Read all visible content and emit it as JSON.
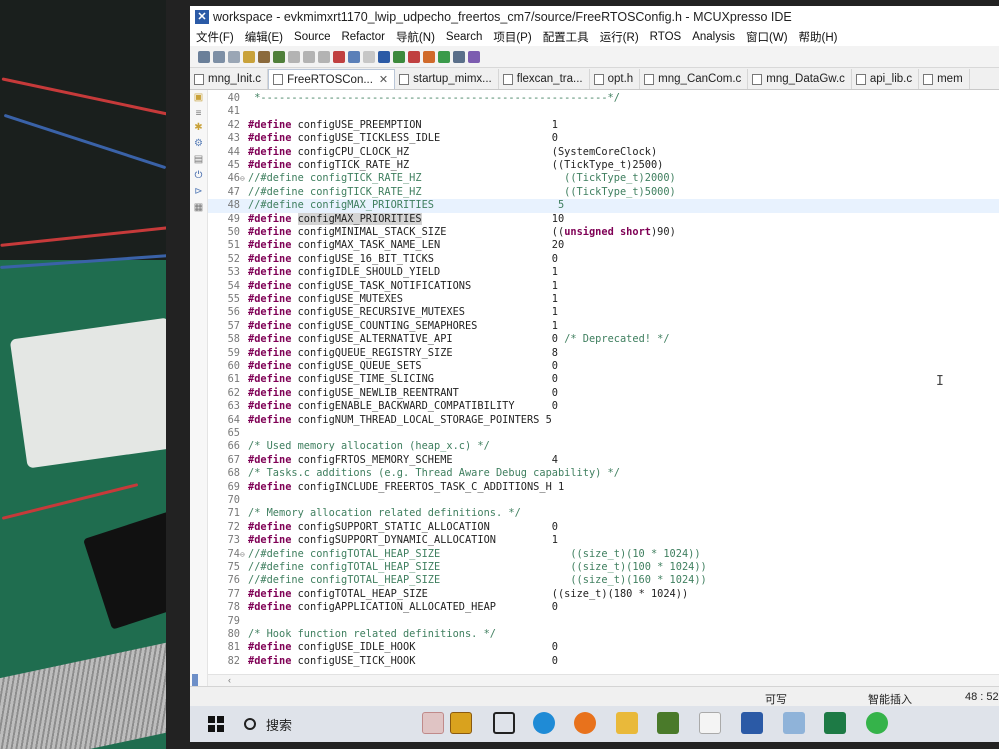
{
  "window": {
    "title": "workspace - evkmimxrt1170_lwip_udpecho_freertos_cm7/source/FreeRTOSConfig.h - MCUXpresso IDE",
    "app_icon": "x-icon"
  },
  "menu": [
    "文件(F)",
    "编辑(E)",
    "Source",
    "Refactor",
    "导航(N)",
    "Search",
    "项目(P)",
    "配置工具",
    "运行(R)",
    "RTOS",
    "Analysis",
    "窗口(W)",
    "帮助(H)"
  ],
  "tabs": [
    {
      "label": "mng_Init.c",
      "active": false,
      "closable": false
    },
    {
      "label": "FreeRTOSCon...",
      "active": true,
      "closable": true
    },
    {
      "label": "startup_mimx...",
      "active": false,
      "closable": false
    },
    {
      "label": "flexcan_tra...",
      "active": false,
      "closable": false
    },
    {
      "label": "opt.h",
      "active": false,
      "closable": false
    },
    {
      "label": "mng_CanCom.c",
      "active": false,
      "closable": false
    },
    {
      "label": "mng_DataGw.c",
      "active": false,
      "closable": false
    },
    {
      "label": "api_lib.c",
      "active": false,
      "closable": false
    },
    {
      "label": "mem",
      "active": false,
      "closable": false
    }
  ],
  "code_lines": [
    {
      "n": "40",
      "parts": [
        {
          "t": " *--------------------------------------------------------*/",
          "c": "cm"
        }
      ]
    },
    {
      "n": "41",
      "parts": []
    },
    {
      "n": "42",
      "parts": [
        {
          "t": "#define",
          "c": "kw"
        },
        {
          "t": " configUSE_PREEMPTION                     1"
        }
      ]
    },
    {
      "n": "43",
      "parts": [
        {
          "t": "#define",
          "c": "kw"
        },
        {
          "t": " configUSE_TICKLESS_IDLE                  0"
        }
      ]
    },
    {
      "n": "44",
      "parts": [
        {
          "t": "#define",
          "c": "kw"
        },
        {
          "t": " configCPU_CLOCK_HZ                       (SystemCoreClock)"
        }
      ]
    },
    {
      "n": "45",
      "parts": [
        {
          "t": "#define",
          "c": "kw"
        },
        {
          "t": " configTICK_RATE_HZ                       ((TickType_t)2500)"
        }
      ]
    },
    {
      "n": "46",
      "fold": "⊖",
      "parts": [
        {
          "t": "//#define configTICK_RATE_HZ                       ((TickType_t)2000)",
          "c": "cm"
        }
      ]
    },
    {
      "n": "47",
      "parts": [
        {
          "t": "//#define configTICK_RATE_HZ                       ((TickType_t)5000)",
          "c": "cm"
        }
      ]
    },
    {
      "n": "48",
      "hl": true,
      "parts": [
        {
          "t": "//#define configMAX_PRIORITIES                    5",
          "c": "cm"
        }
      ]
    },
    {
      "n": "49",
      "parts": [
        {
          "t": "#define",
          "c": "kw"
        },
        {
          "t": " "
        },
        {
          "t": "configMAX_PRIORITIES",
          "c": "sel"
        },
        {
          "t": "                     10"
        }
      ]
    },
    {
      "n": "50",
      "parts": [
        {
          "t": "#define",
          "c": "kw"
        },
        {
          "t": " configMINIMAL_STACK_SIZE                 (("
        },
        {
          "t": "unsigned short",
          "c": "kw"
        },
        {
          "t": ")90)"
        }
      ]
    },
    {
      "n": "51",
      "parts": [
        {
          "t": "#define",
          "c": "kw"
        },
        {
          "t": " configMAX_TASK_NAME_LEN                  20"
        }
      ]
    },
    {
      "n": "52",
      "parts": [
        {
          "t": "#define",
          "c": "kw"
        },
        {
          "t": " configUSE_16_BIT_TICKS                   0"
        }
      ]
    },
    {
      "n": "53",
      "parts": [
        {
          "t": "#define",
          "c": "kw"
        },
        {
          "t": " configIDLE_SHOULD_YIELD                  1"
        }
      ]
    },
    {
      "n": "54",
      "parts": [
        {
          "t": "#define",
          "c": "kw"
        },
        {
          "t": " configUSE_TASK_NOTIFICATIONS             1"
        }
      ]
    },
    {
      "n": "55",
      "parts": [
        {
          "t": "#define",
          "c": "kw"
        },
        {
          "t": " configUSE_MUTEXES                        1"
        }
      ]
    },
    {
      "n": "56",
      "parts": [
        {
          "t": "#define",
          "c": "kw"
        },
        {
          "t": " configUSE_RECURSIVE_MUTEXES              1"
        }
      ]
    },
    {
      "n": "57",
      "parts": [
        {
          "t": "#define",
          "c": "kw"
        },
        {
          "t": " configUSE_COUNTING_SEMAPHORES            1"
        }
      ]
    },
    {
      "n": "58",
      "parts": [
        {
          "t": "#define",
          "c": "kw"
        },
        {
          "t": " configUSE_ALTERNATIVE_API                0 "
        },
        {
          "t": "/* Deprecated! */",
          "c": "cm"
        }
      ]
    },
    {
      "n": "59",
      "parts": [
        {
          "t": "#define",
          "c": "kw"
        },
        {
          "t": " configQUEUE_REGISTRY_SIZE                8"
        }
      ]
    },
    {
      "n": "60",
      "parts": [
        {
          "t": "#define",
          "c": "kw"
        },
        {
          "t": " configUSE_QUEUE_SETS                     0"
        }
      ]
    },
    {
      "n": "61",
      "parts": [
        {
          "t": "#define",
          "c": "kw"
        },
        {
          "t": " configUSE_TIME_SLICING                   0"
        }
      ]
    },
    {
      "n": "62",
      "parts": [
        {
          "t": "#define",
          "c": "kw"
        },
        {
          "t": " configUSE_NEWLIB_REENTRANT               0"
        }
      ]
    },
    {
      "n": "63",
      "parts": [
        {
          "t": "#define",
          "c": "kw"
        },
        {
          "t": " configENABLE_BACKWARD_COMPATIBILITY      0"
        }
      ]
    },
    {
      "n": "64",
      "parts": [
        {
          "t": "#define",
          "c": "kw"
        },
        {
          "t": " configNUM_THREAD_LOCAL_STORAGE_POINTERS 5"
        }
      ]
    },
    {
      "n": "65",
      "parts": []
    },
    {
      "n": "66",
      "parts": [
        {
          "t": "/* Used memory allocation (heap_x.c) */",
          "c": "cm"
        }
      ]
    },
    {
      "n": "67",
      "parts": [
        {
          "t": "#define",
          "c": "kw"
        },
        {
          "t": " configFRTOS_MEMORY_SCHEME                4"
        }
      ]
    },
    {
      "n": "68",
      "parts": [
        {
          "t": "/* Tasks.c additions (e.g. Thread Aware Debug capability) */",
          "c": "cm"
        }
      ]
    },
    {
      "n": "69",
      "parts": [
        {
          "t": "#define",
          "c": "kw"
        },
        {
          "t": " configINCLUDE_FREERTOS_TASK_C_ADDITIONS_H 1"
        }
      ]
    },
    {
      "n": "70",
      "parts": []
    },
    {
      "n": "71",
      "parts": [
        {
          "t": "/* Memory allocation related definitions. */",
          "c": "cm"
        }
      ]
    },
    {
      "n": "72",
      "parts": [
        {
          "t": "#define",
          "c": "kw"
        },
        {
          "t": " configSUPPORT_STATIC_ALLOCATION          0"
        }
      ]
    },
    {
      "n": "73",
      "parts": [
        {
          "t": "#define",
          "c": "kw"
        },
        {
          "t": " configSUPPORT_DYNAMIC_ALLOCATION         1"
        }
      ]
    },
    {
      "n": "74",
      "fold": "⊖",
      "parts": [
        {
          "t": "//#define configTOTAL_HEAP_SIZE                     ((size_t)(10 * 1024))",
          "c": "cm"
        }
      ]
    },
    {
      "n": "75",
      "parts": [
        {
          "t": "//#define configTOTAL_HEAP_SIZE                     ((size_t)(100 * 1024))",
          "c": "cm"
        }
      ]
    },
    {
      "n": "76",
      "parts": [
        {
          "t": "//#define configTOTAL_HEAP_SIZE                     ((size_t)(160 * 1024))",
          "c": "cm"
        }
      ]
    },
    {
      "n": "77",
      "parts": [
        {
          "t": "#define",
          "c": "kw"
        },
        {
          "t": " configTOTAL_HEAP_SIZE                    ((size_t)(180 * 1024))"
        }
      ]
    },
    {
      "n": "78",
      "parts": [
        {
          "t": "#define",
          "c": "kw"
        },
        {
          "t": " configAPPLICATION_ALLOCATED_HEAP         0"
        }
      ]
    },
    {
      "n": "79",
      "parts": []
    },
    {
      "n": "80",
      "parts": [
        {
          "t": "/* Hook function related definitions. */",
          "c": "cm"
        }
      ]
    },
    {
      "n": "81",
      "parts": [
        {
          "t": "#define",
          "c": "kw"
        },
        {
          "t": " configUSE_IDLE_HOOK                      0"
        }
      ]
    },
    {
      "n": "82",
      "parts": [
        {
          "t": "#define",
          "c": "kw"
        },
        {
          "t": " configUSE_TICK_HOOK                      0"
        }
      ]
    }
  ],
  "status": {
    "writable": "可写",
    "insert_mode": "智能插入",
    "cursor_position": "48 : 52"
  },
  "taskbar": {
    "search_label": "搜索",
    "apps": [
      "paint-icon",
      "sunflower-icon",
      "task-view-icon",
      "edge-icon",
      "firefox-icon",
      "explorer-icon",
      "jar-icon",
      "word-icon",
      "mcuxpresso-icon",
      "device-icon",
      "excel-icon",
      "wechat-icon"
    ]
  },
  "colors": {
    "keyword": "#7f0055",
    "comment": "#3f7f5f",
    "current_line": "#e8f2fe",
    "selection": "#d4d4d4"
  }
}
